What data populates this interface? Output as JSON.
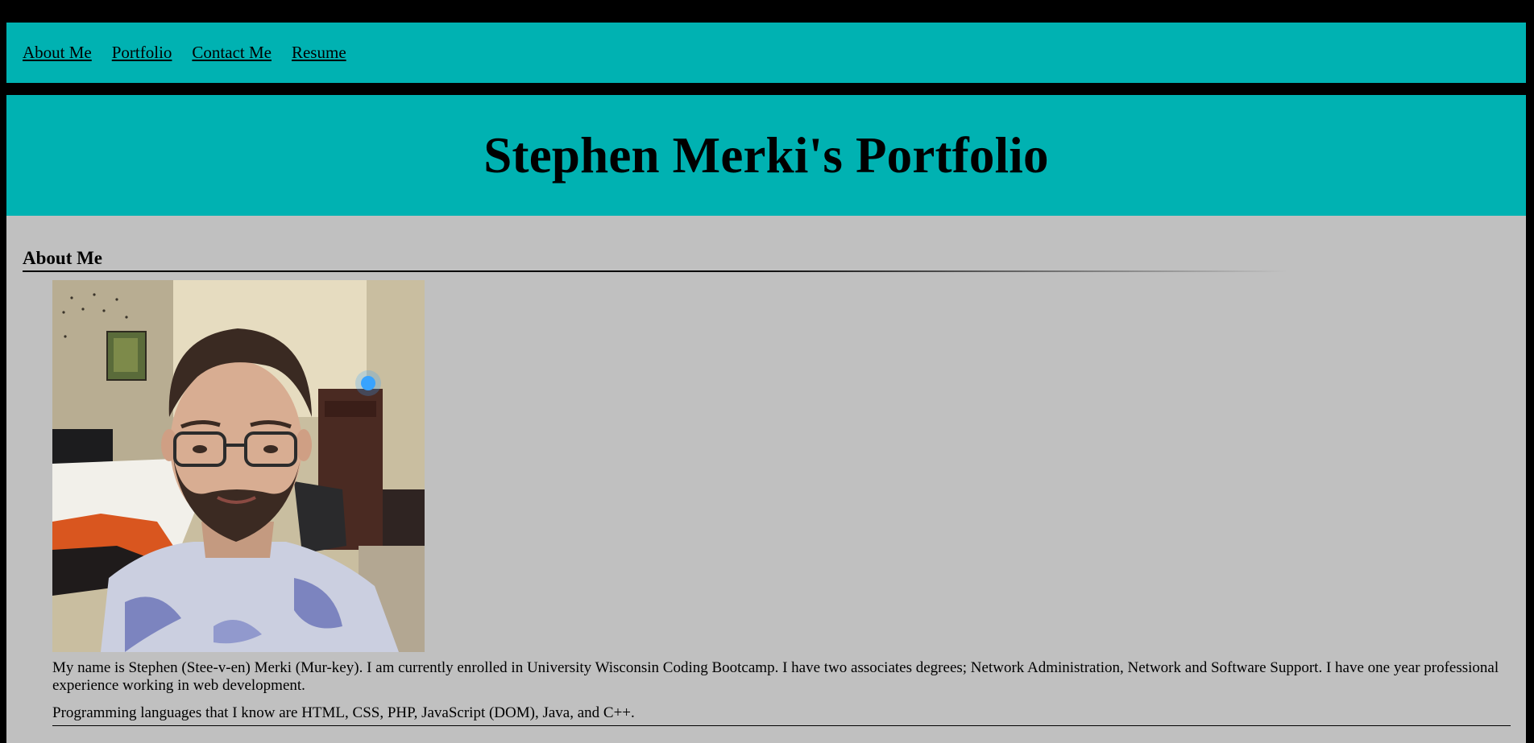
{
  "nav": {
    "items": [
      {
        "label": "About Me"
      },
      {
        "label": "Portfolio"
      },
      {
        "label": "Contact Me"
      },
      {
        "label": "Resume"
      }
    ]
  },
  "header": {
    "title": "Stephen Merki's Portfolio"
  },
  "about": {
    "heading": "About Me",
    "bio": "My name is Stephen (Stee-v-en) Merki (Mur-key). I am currently enrolled in University Wisconsin Coding Bootcamp. I have two associates degrees; Network Administration, Network and Software Support. I have one year professional experience working in web development.",
    "languages": "Programming languages that I know are HTML, CSS, PHP, JavaScript (DOM), Java, and C++."
  },
  "colors": {
    "page_background": "#000000",
    "accent": "#00b2b2",
    "content_background": "#c0c0c0"
  }
}
